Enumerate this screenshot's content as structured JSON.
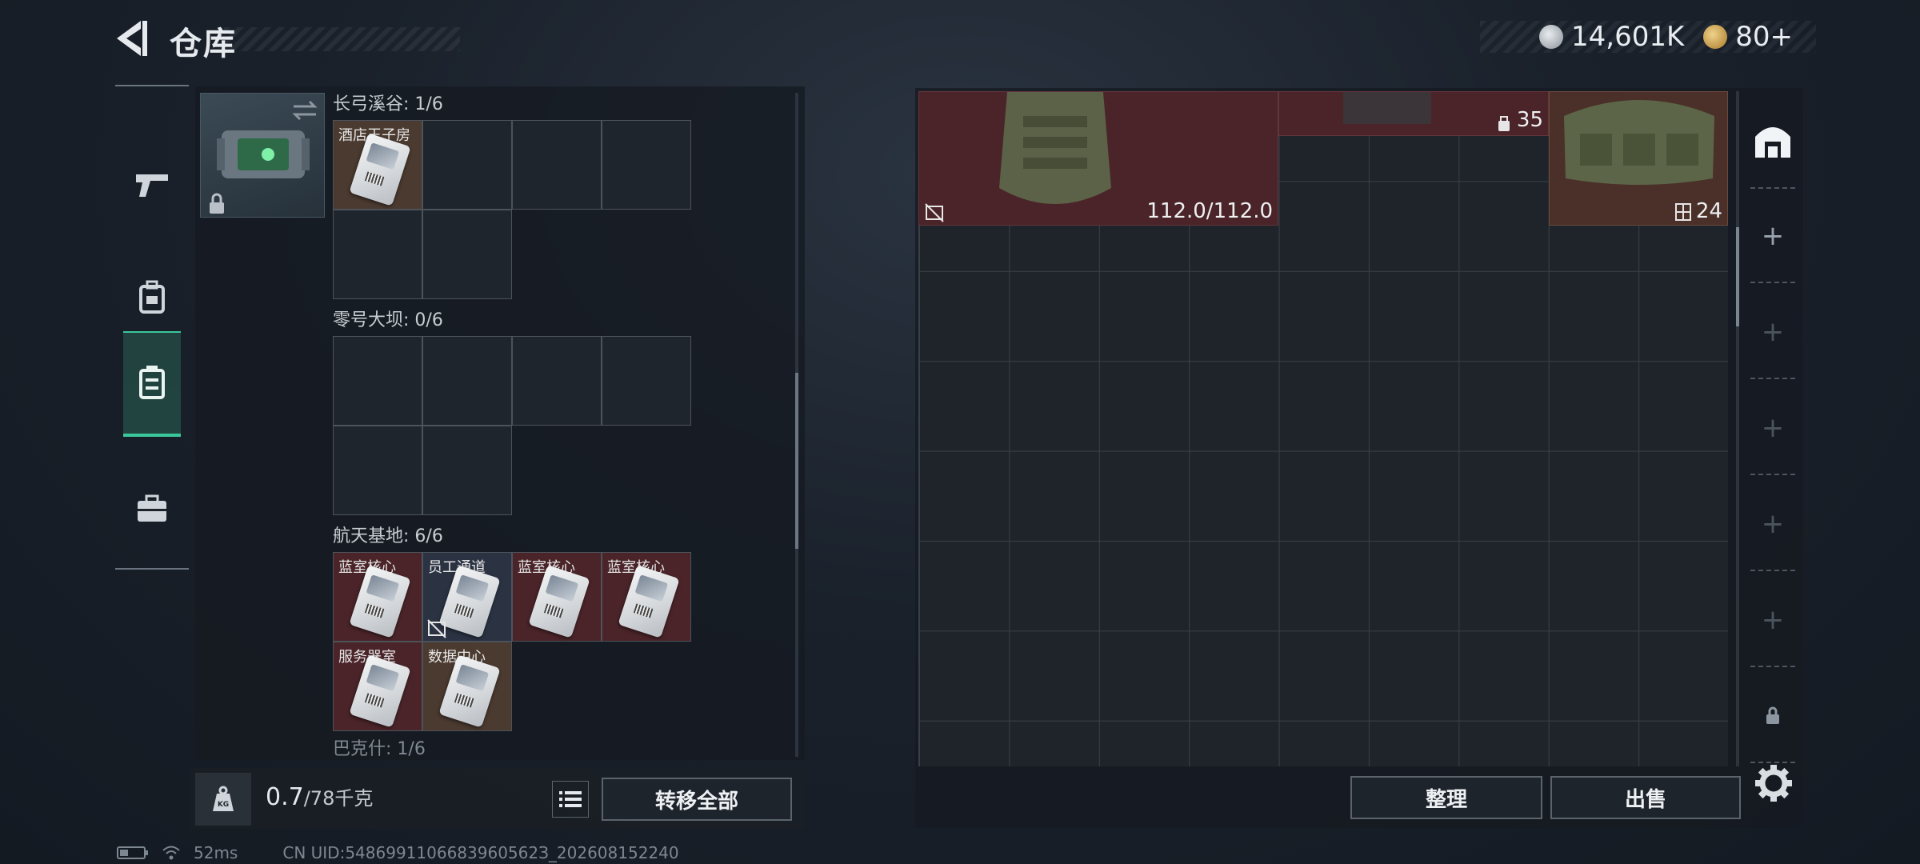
{
  "header": {
    "title": "仓库",
    "currency_silver": "14,601K",
    "currency_gold": "80+"
  },
  "nav": {
    "items": [
      {
        "icon": "pistol-icon"
      },
      {
        "icon": "backpack-icon"
      },
      {
        "icon": "container-icon",
        "active": true
      },
      {
        "icon": "briefcase-icon"
      }
    ]
  },
  "keycard_case": {
    "groups": [
      {
        "label": "长弓溪谷: 1/6",
        "slots": [
          {
            "name": "酒店王子房",
            "color": "brown"
          }
        ]
      },
      {
        "label": "零号大坝: 0/6",
        "slots": []
      },
      {
        "label": "航天基地: 6/6",
        "slots": [
          {
            "name": "蓝室核心",
            "color": "red"
          },
          {
            "name": "员工通道",
            "color": "blue"
          },
          {
            "name": "蓝室核心",
            "color": "red"
          },
          {
            "name": "蓝室核心",
            "color": "red"
          },
          {
            "name": "服务器室",
            "color": "red"
          },
          {
            "name": "数据中心",
            "color": "brown"
          }
        ]
      },
      {
        "label": "巴克什: 1/6"
      }
    ]
  },
  "weight": {
    "current": "0.7",
    "max": "/78千克",
    "icon_label": "KG"
  },
  "buttons": {
    "transfer_all": "转移全部",
    "sort": "整理",
    "sell": "出售"
  },
  "stash": {
    "vest_durability": "112.0/112.0",
    "unknown_item_count": "35",
    "bag_capacity": "24"
  },
  "status_bar": {
    "ping": "52ms",
    "uid": "CN UID:5486991106683960562З_202608152240"
  }
}
